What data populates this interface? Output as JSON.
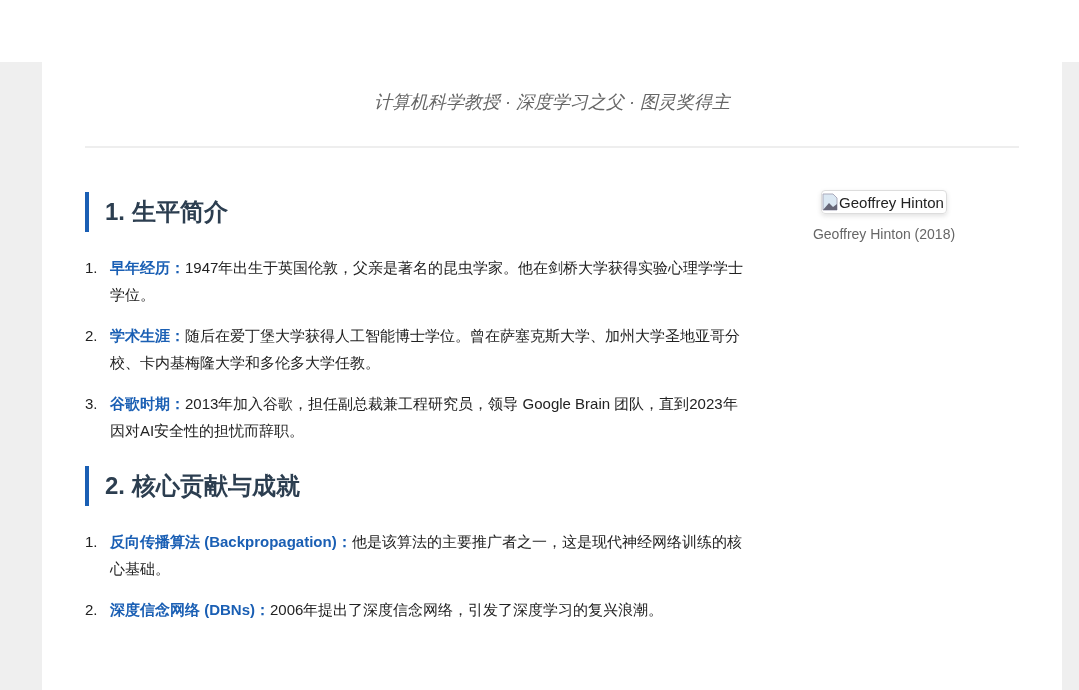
{
  "header": {
    "subtitle": "计算机科学教授 · 深度学习之父 · 图灵奖得主"
  },
  "sections": [
    {
      "heading": "1. 生平简介",
      "items": [
        {
          "number": "1.",
          "term": "早年经历：",
          "text": "1947年出生于英国伦敦，父亲是著名的昆虫学家。他在剑桥大学获得实验心理学学士学位。"
        },
        {
          "number": "2.",
          "term": "学术生涯：",
          "text": "随后在爱丁堡大学获得人工智能博士学位。曾在萨塞克斯大学、加州大学圣地亚哥分校、卡内基梅隆大学和多伦多大学任教。"
        },
        {
          "number": "3.",
          "term": "谷歌时期：",
          "text": "2013年加入谷歌，担任副总裁兼工程研究员，领导 Google Brain 团队，直到2023年因对AI安全性的担忧而辞职。"
        }
      ]
    },
    {
      "heading": "2. 核心贡献与成就",
      "items": [
        {
          "number": "1.",
          "term": "反向传播算法 (Backpropagation)：",
          "text": "他是该算法的主要推广者之一，这是现代神经网络训练的核心基础。"
        },
        {
          "number": "2.",
          "term": "深度信念网络 (DBNs)：",
          "text": "2006年提出了深度信念网络，引发了深度学习的复兴浪潮。"
        }
      ]
    }
  ],
  "figure": {
    "alt_text": "Geoffrey Hinton",
    "caption": "Geoffrey Hinton (2018)"
  }
}
